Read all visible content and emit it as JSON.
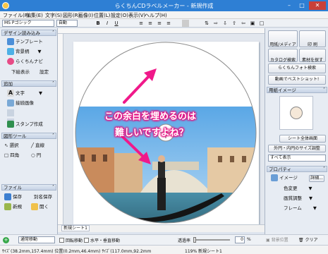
{
  "window": {
    "title": "らくちんCDラベルメーカー - 新規作成"
  },
  "menu": [
    "ファイル(F)",
    "編集(E)",
    "文字(S)",
    "図形(R)",
    "画像(I)",
    "位置(L)",
    "設定(O)",
    "表示(V)",
    "ヘルプ(H)"
  ],
  "toolbar": {
    "font": "MS Pゴシック",
    "size": "自動"
  },
  "left_panel": {
    "design_header": "デザイン読み込み",
    "design_items": [
      "テンプレート",
      "背景柄",
      "らくちんナビ"
    ],
    "design_links": [
      "下絵表示",
      "設定"
    ],
    "add_header": "追加",
    "add_items": [
      "文字",
      "接続画像",
      "スタンプ作成"
    ],
    "shape_header": "図形ツール",
    "shape_items": [
      "選択",
      "直線",
      "四角",
      "円"
    ],
    "file_header": "ファイル",
    "file_items": [
      "保存",
      "別名保存",
      "新規",
      "開く"
    ]
  },
  "right_panel": {
    "buttons": [
      "用紙/メディア",
      "印 刷",
      "カタログ検索",
      "素材を探す",
      "らくちんフォト検索",
      "動画でベストショット!"
    ],
    "image_header": "用紙イメージ",
    "fullscreen_button": "シート全体画面",
    "size_adjust": "外円・内円のサイズ調整",
    "show_all": "すべて表示",
    "property_header": "プロパティ",
    "image_label": "イメージ",
    "detail_button": "詳細...",
    "props": [
      "色変更",
      "画質調整",
      "フレーム"
    ]
  },
  "canvas": {
    "overlay_line1": "この余白を埋めるのは",
    "overlay_line2": "難しいですよね？"
  },
  "sheet_tab": "新規シート1",
  "bottom": {
    "move_mode": "通常移動",
    "rotate": "回転移動",
    "hv_move": "水平・垂直移動",
    "opacity_label": "透過率",
    "opacity_value": "0",
    "opacity_unit": "%",
    "bg_designate": "背景位置",
    "clear": "クリア"
  },
  "status": {
    "position": "ｻｲｽﾞ(38.2mm,157.4mm) 位置(0.2mm,46.4mm) ｻｲｽﾞ(117.0mm,92.2mm",
    "sheet_info": "119% 新規シート1"
  },
  "colors": {
    "titlebar": "#2e7fd4",
    "overlay_pink": "#f0198a"
  }
}
